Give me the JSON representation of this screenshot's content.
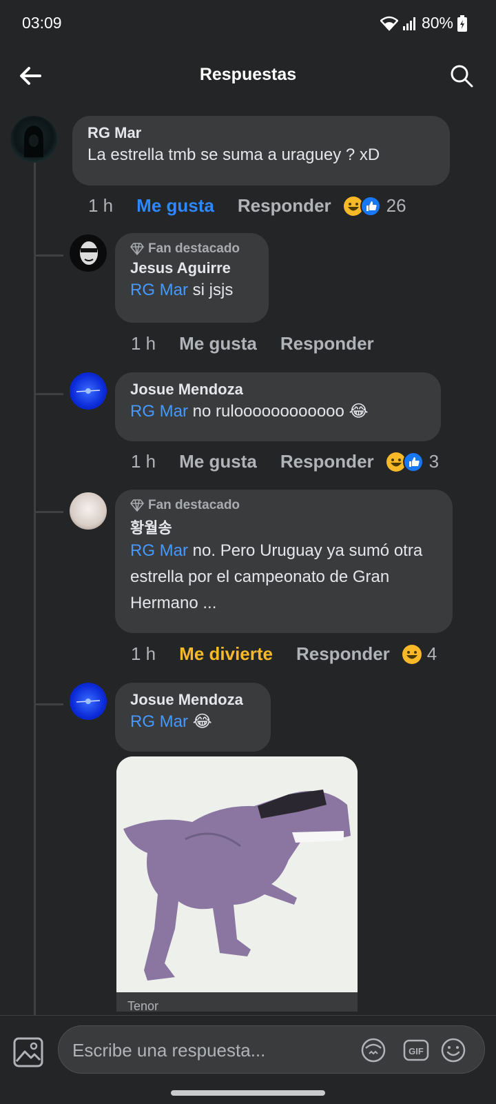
{
  "status_bar": {
    "time": "03:09",
    "battery": "80%"
  },
  "header": {
    "title": "Respuestas"
  },
  "comments": [
    {
      "author": "RG Mar",
      "text": "La estrella tmb se suma a uraguey ? xD",
      "time": "1 h",
      "like_label": "Me gusta",
      "reply_label": "Responder",
      "reaction_count": "26"
    },
    {
      "badge": "Fan destacado",
      "author": "Jesus Aguirre",
      "mention": "RG Mar",
      "text": "si jsjs",
      "time": "1 h",
      "like_label": "Me gusta",
      "reply_label": "Responder"
    },
    {
      "author": "Josue Mendoza",
      "mention": "RG Mar",
      "text": "no ruloooooooooooo 😂",
      "time": "1 h",
      "like_label": "Me gusta",
      "reply_label": "Responder",
      "reaction_count": "3"
    },
    {
      "badge": "Fan destacado",
      "author": "황월송",
      "mention": "RG Mar",
      "text": "no. Pero Uruguay ya sumó otra estrella por el campeonato de Gran Hermano ...",
      "time": "1 h",
      "like_label": "Me divierte",
      "reply_label": "Responder",
      "reaction_count": "4"
    },
    {
      "author": "Josue Mendoza",
      "mention": "RG Mar",
      "text": "😂",
      "gif_provider": "Tenor"
    }
  ],
  "composer": {
    "placeholder": "Escribe una respuesta..."
  },
  "colors": {
    "background": "#242526",
    "bubble": "#3a3b3c",
    "accent_like": "#2d88ff",
    "accent_haha": "#f7b928",
    "mention": "#4599ff"
  },
  "icons": [
    "back-arrow-icon",
    "search-icon",
    "diamond-icon",
    "haha-reaction-icon",
    "like-reaction-icon",
    "photo-icon",
    "avatar-sticker-icon",
    "gif-icon",
    "emoji-icon",
    "wifi-icon",
    "signal-icon",
    "battery-icon"
  ]
}
